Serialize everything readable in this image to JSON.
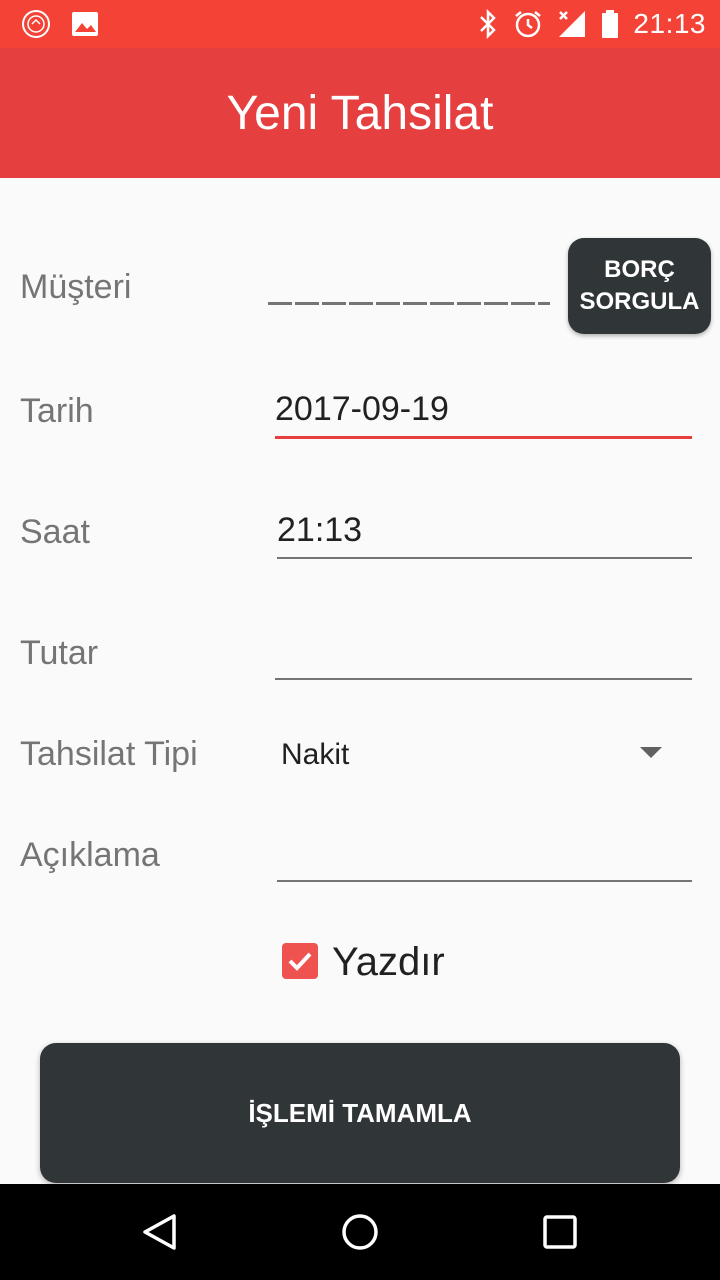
{
  "status_bar": {
    "time": "21:13",
    "icons": [
      "app-logo-icon",
      "image-icon",
      "bluetooth-icon",
      "alarm-icon",
      "no-signal-icon",
      "battery-icon"
    ]
  },
  "toolbar": {
    "title": "Yeni Tahsilat"
  },
  "form": {
    "musteri_label": "Müşteri",
    "musteri_value": "",
    "borc_button": "BORÇ\nSORGULA",
    "tarih_label": "Tarih",
    "tarih_value": "2017-09-19",
    "saat_label": "Saat",
    "saat_value": "21:13",
    "tutar_label": "Tutar",
    "tutar_value": "",
    "tip_label": "Tahsilat Tipi",
    "tip_value": "Nakit",
    "aciklama_label": "Açıklama",
    "aciklama_value": "",
    "print_label": "Yazdır",
    "print_checked": true
  },
  "actions": {
    "complete_button": "İŞLEMİ TAMAMLA"
  },
  "colors": {
    "primary": "#e53f3f",
    "status_bar": "#f44336",
    "button": "#303638"
  },
  "nav_bar": {
    "icons": [
      "back-icon",
      "home-icon",
      "recents-icon"
    ]
  }
}
